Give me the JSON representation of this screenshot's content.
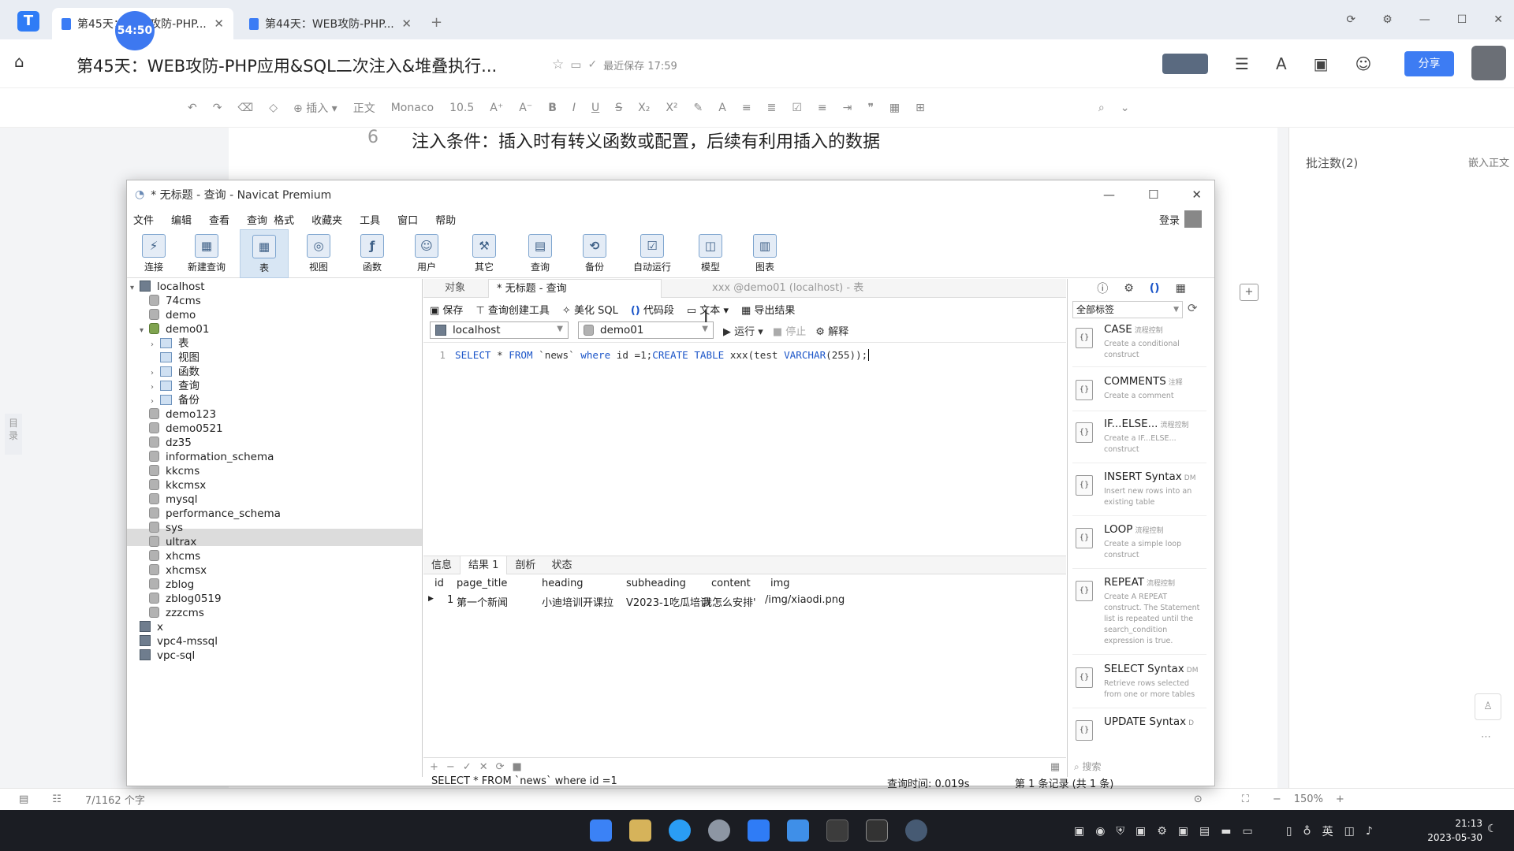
{
  "browser": {
    "tabs": [
      {
        "label": "第45天：WEB攻防-PHP...",
        "close": "✕"
      },
      {
        "label": "第44天：WEB攻防-PHP...",
        "close": "✕"
      }
    ],
    "new_tab": "+",
    "timer": "54:50"
  },
  "doc": {
    "title": "第45天：WEB攻防-PHP应用&SQL二次注入&堆叠执行...",
    "saved": "最近保存 17:59",
    "share_label": "分享",
    "line_number": "6",
    "line_text": "注入条件：插入时有转义函数或配置，后续有利用插入的数据",
    "toolbar": [
      "插入",
      "正文",
      "Monaco",
      "10.5"
    ],
    "notes": "批注数(2)",
    "embed": "嵌入正文",
    "sidebar_label": "目录",
    "wordcount": "7/1162 个字",
    "zoom": "150%"
  },
  "navicat": {
    "title": "* 无标题 - 查询 - Navicat Premium",
    "menu": [
      "文件",
      "编辑",
      "查看",
      "查询",
      "格式",
      "收藏夹",
      "工具",
      "窗口",
      "帮助"
    ],
    "login": "登录",
    "toolbar": [
      {
        "label": "连接",
        "icon": "plug-icon"
      },
      {
        "label": "新建查询",
        "icon": "new-query-icon"
      },
      {
        "label": "表",
        "icon": "table-icon"
      },
      {
        "label": "视图",
        "icon": "view-icon"
      },
      {
        "label": "函数",
        "icon": "function-icon"
      },
      {
        "label": "用户",
        "icon": "user-icon"
      },
      {
        "label": "其它",
        "icon": "other-icon"
      },
      {
        "label": "查询",
        "icon": "query-icon"
      },
      {
        "label": "备份",
        "icon": "backup-icon"
      },
      {
        "label": "自动运行",
        "icon": "autorun-icon"
      },
      {
        "label": "模型",
        "icon": "model-icon"
      },
      {
        "label": "图表",
        "icon": "chart-icon"
      }
    ],
    "tree": {
      "server": "localhost",
      "dbs_before": [
        "74cms",
        "demo"
      ],
      "open_db": "demo01",
      "children": [
        "表",
        "视图",
        "函数",
        "查询",
        "备份"
      ],
      "dbs_after": [
        "demo123",
        "demo0521",
        "dz35",
        "information_schema",
        "kkcms",
        "kkcmsx",
        "mysql",
        "performance_schema",
        "sys",
        "ultrax",
        "xhcms",
        "xhcmsx",
        "zblog",
        "zblog0519",
        "zzzcms"
      ],
      "servers": [
        "x",
        "vpc4-mssql",
        "vpc-sql"
      ]
    },
    "editor_tabs": {
      "object": "对象",
      "query": "* 无标题 - 查询",
      "table": "xxx @demo01 (localhost) - 表"
    },
    "query_tools": [
      "保存",
      "查询创建工具",
      "美化 SQL",
      "代码段",
      "文本",
      "导出结果"
    ],
    "connection": "localhost",
    "database": "demo01",
    "run": "运行",
    "stop": "停止",
    "explain": "解释",
    "sql": {
      "line_no": "1",
      "select": "SELECT",
      "star_from": " * ",
      "from": "FROM",
      "table": " `news` ",
      "where": "where",
      "cond": " id =1;",
      "create": "CREATE TABLE",
      "rest1": " xxx(test ",
      "varchar": "VARCHAR",
      "rest2": "(255));"
    },
    "result_tabs": [
      "信息",
      "结果 1",
      "剖析",
      "状态"
    ],
    "columns": [
      "id",
      "page_title",
      "heading",
      "subheading",
      "content",
      "img"
    ],
    "row": [
      "1",
      "第一个新闻",
      "小迪培训开课拉",
      "V2023-1吃瓜培训",
      "我怎么安排'",
      "/img/xiaodi.png"
    ],
    "status_sql": "SELECT * FROM `news` where id =1",
    "query_time": "查询时间: 0.019s",
    "records": "第 1 条记录 (共 1 条)",
    "snippet_filter": "全部标签",
    "snippet_search": "搜索",
    "snippets": [
      {
        "name": "CASE",
        "tag": "流程控制",
        "desc": "Create a conditional construct"
      },
      {
        "name": "COMMENTS",
        "tag": "注释",
        "desc": "Create a comment"
      },
      {
        "name": "IF...ELSE...",
        "tag": "流程控制",
        "desc": "Create a IF...ELSE... construct"
      },
      {
        "name": "INSERT Syntax",
        "tag": "DM",
        "desc": "Insert new rows into an existing table"
      },
      {
        "name": "LOOP",
        "tag": "流程控制",
        "desc": "Create a simple loop construct"
      },
      {
        "name": "REPEAT",
        "tag": "流程控制",
        "desc": "Create A REPEAT construct. The Statement list is repeated until the search_condition expression is true."
      },
      {
        "name": "SELECT Syntax",
        "tag": "DM",
        "desc": "Retrieve rows selected from one or more tables"
      },
      {
        "name": "UPDATE Syntax",
        "tag": "D",
        "desc": ""
      }
    ]
  },
  "taskbar": {
    "ime": "英",
    "time": "21:13",
    "date": "2023-05-30"
  },
  "colors": {
    "accent": "#3d7cf3",
    "taskbar": "#1b1d23",
    "sql_keyword": "#1b55c8"
  }
}
